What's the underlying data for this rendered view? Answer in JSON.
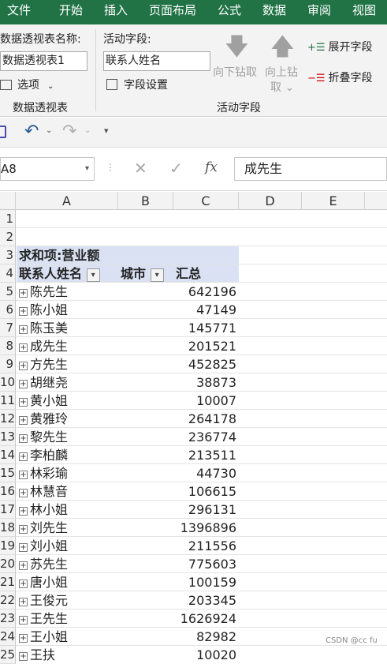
{
  "tabs": [
    "文件",
    "开始",
    "插入",
    "页面布局",
    "公式",
    "数据",
    "审阅",
    "视图"
  ],
  "ribbon": {
    "pivot_name_label": "数据透视表名称:",
    "pivot_name_value": "数据透视表1",
    "options_label": "选项",
    "group1_label": "数据透视表",
    "active_field_label": "活动字段:",
    "active_field_value": "联系人姓名",
    "field_settings_label": "字段设置",
    "drill_down_label": "向下钻取",
    "drill_up_label_1": "向上钻",
    "drill_up_label_2": "取",
    "expand_label": "展开字段",
    "collapse_label": "折叠字段",
    "group2_label": "活动字段"
  },
  "formula_bar": {
    "name_box": "A8",
    "fx_label": "fx",
    "content": "成先生"
  },
  "columns": [
    "A",
    "B",
    "C",
    "D",
    "E"
  ],
  "pivot": {
    "title": "求和项:营业额",
    "header_name": "联系人姓名",
    "header_city": "城市",
    "header_total": "汇总"
  },
  "rows": [
    {
      "n": "1"
    },
    {
      "n": "2"
    },
    {
      "n": "25",
      "name": "王扶",
      "total": "10020"
    }
  ],
  "data_rows": [
    {
      "n": "5",
      "name": "陈先生",
      "total": "642196"
    },
    {
      "n": "6",
      "name": "陈小姐",
      "total": "47149"
    },
    {
      "n": "7",
      "name": "陈玉美",
      "total": "145771"
    },
    {
      "n": "8",
      "name": "成先生",
      "total": "201521"
    },
    {
      "n": "9",
      "name": "方先生",
      "total": "452825"
    },
    {
      "n": "10",
      "name": "胡继尧",
      "total": "38873"
    },
    {
      "n": "11",
      "name": "黄小姐",
      "total": "10007"
    },
    {
      "n": "12",
      "name": "黄雅玲",
      "total": "264178"
    },
    {
      "n": "13",
      "name": "黎先生",
      "total": "236774"
    },
    {
      "n": "14",
      "name": "李柏麟",
      "total": "213511"
    },
    {
      "n": "15",
      "name": "林彩瑜",
      "total": "44730"
    },
    {
      "n": "16",
      "name": "林慧音",
      "total": "106615"
    },
    {
      "n": "17",
      "name": "林小姐",
      "total": "296131"
    },
    {
      "n": "18",
      "name": "刘先生",
      "total": "1396896"
    },
    {
      "n": "19",
      "name": "刘小姐",
      "total": "211556"
    },
    {
      "n": "20",
      "name": "苏先生",
      "total": "775603"
    },
    {
      "n": "21",
      "name": "唐小姐",
      "total": "100159"
    },
    {
      "n": "22",
      "name": "王俊元",
      "total": "203345"
    },
    {
      "n": "23",
      "name": "王先生",
      "total": "1626924"
    },
    {
      "n": "24",
      "name": "王小姐",
      "total": "82982"
    }
  ],
  "watermark": "CSDN @cc fu"
}
